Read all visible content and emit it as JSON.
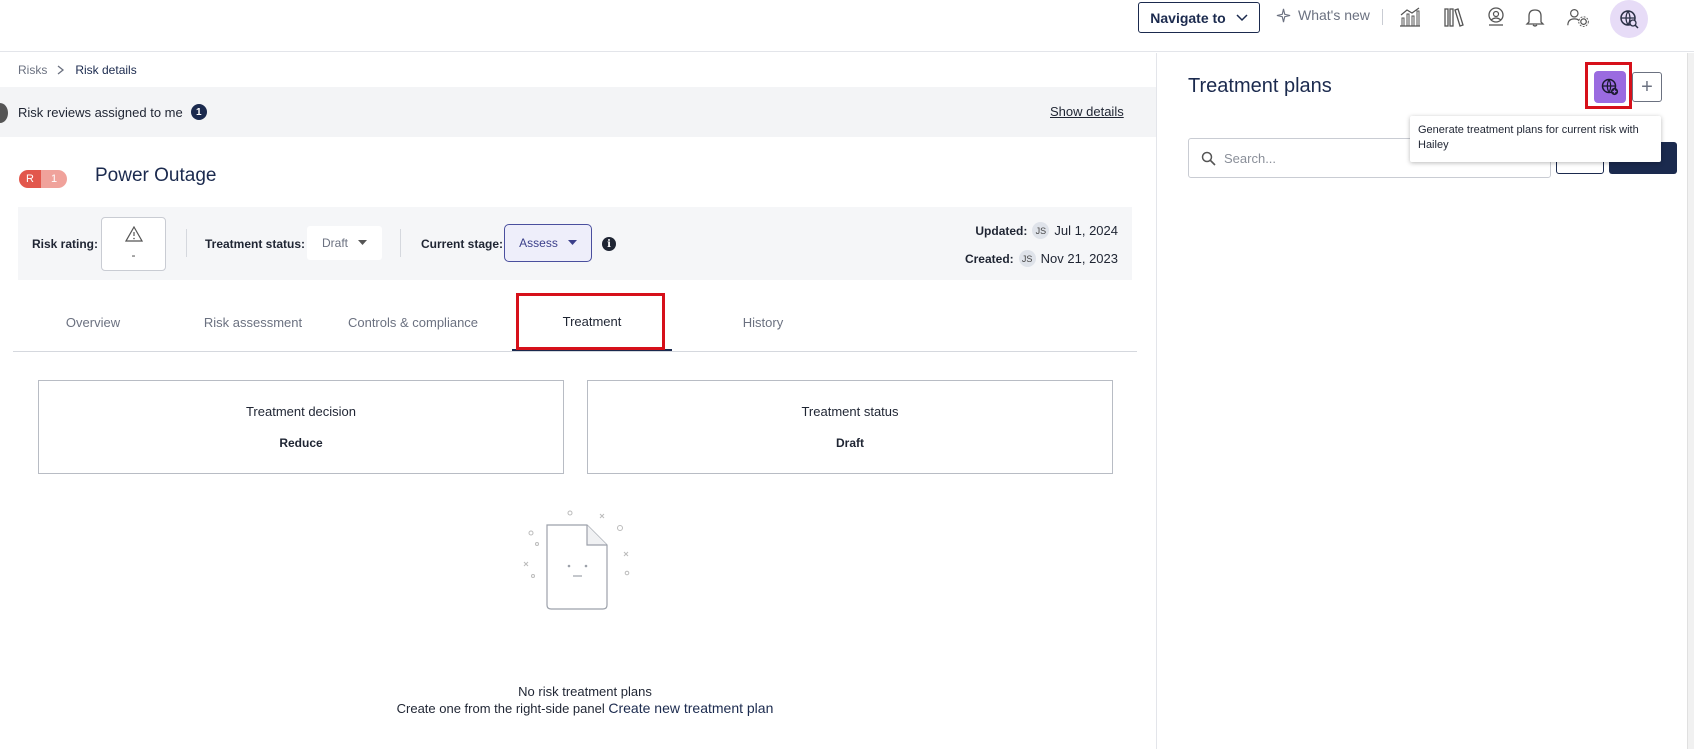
{
  "topbar": {
    "navigate_label": "Navigate to",
    "whats_new_label": "What's new",
    "icons": [
      "analytics-icon",
      "library-icon",
      "profile-badge-icon",
      "bell-icon",
      "user-settings-icon",
      "hailey-ai-icon"
    ]
  },
  "breadcrumb": {
    "root": "Risks",
    "current": "Risk details"
  },
  "reviews": {
    "text": "Risk reviews assigned to me",
    "count": "1",
    "show_details": "Show details"
  },
  "risk": {
    "badge_letter": "R",
    "badge_number": "1",
    "title": "Power Outage"
  },
  "info": {
    "rating_label": "Risk rating:",
    "rating_value": "-",
    "treatment_status_label": "Treatment status:",
    "treatment_status_value": "Draft",
    "stage_label": "Current stage:",
    "stage_value": "Assess",
    "updated_label": "Updated:",
    "updated_initials": "JS",
    "updated_date": "Jul 1, 2024",
    "created_label": "Created:",
    "created_initials": "JS",
    "created_date": "Nov 21, 2023"
  },
  "tabs": [
    {
      "label": "Overview"
    },
    {
      "label": "Risk assessment"
    },
    {
      "label": "Controls & compliance"
    },
    {
      "label": "Treatment"
    },
    {
      "label": "History"
    }
  ],
  "active_tab": "Treatment",
  "cards": {
    "decision_title": "Treatment decision",
    "decision_value": "Reduce",
    "status_title": "Treatment status",
    "status_value": "Draft"
  },
  "empty_state": {
    "line1": "No risk treatment plans",
    "line2": "Create one from the right-side panel",
    "link": "Create new treatment plan"
  },
  "right_panel": {
    "title": "Treatment plans",
    "plus": "+",
    "tooltip": "Generate treatment plans for current risk with Hailey",
    "search_placeholder": "Search..."
  },
  "colors": {
    "navy": "#1b2a4e",
    "accent_purple": "#9a6be0",
    "highlight_red": "#d6101a",
    "risk_red": "#e2574c"
  }
}
